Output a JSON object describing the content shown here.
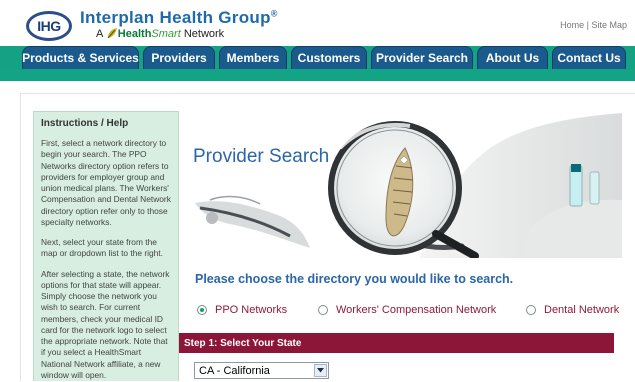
{
  "brand": {
    "logo_text": "IHG",
    "name": "Interplan Health Group",
    "registered": "®",
    "tagline_prefix": "A",
    "tagline_health": "Health",
    "tagline_smart": "Smart",
    "tagline_suffix": "Network"
  },
  "top_links": {
    "home": "Home",
    "separator": " | ",
    "sitemap": "Site Map"
  },
  "nav": {
    "items": [
      {
        "label": "Products & Services"
      },
      {
        "label": "Providers"
      },
      {
        "label": "Members"
      },
      {
        "label": "Customers"
      },
      {
        "label": "Provider Search"
      },
      {
        "label": "About Us"
      },
      {
        "label": "Contact Us"
      }
    ]
  },
  "sidebar": {
    "title": "Instructions / Help",
    "paragraphs": [
      "First, select a network directory to begin your search. The PPO Networks directory option refers to providers for employer group and union medical plans. The Workers' Compensation and Dental Network directory option refer only to those specialty networks.",
      "Next, select your state from the map or dropdown list to the right.",
      "After selecting a state, the network options for that state will appear. Simply choose the network you wish to search. For current members, check your medical ID card for the network logo to select the appropriate network. Note that if you select a HealthSmart National Network affiliate, a new window will open."
    ]
  },
  "main": {
    "title": "Provider Search",
    "prompt": "Please choose the directory you would like to search.",
    "directories": [
      {
        "label": "PPO Networks",
        "checked": true
      },
      {
        "label": "Workers' Compensation Network",
        "checked": false
      },
      {
        "label": "Dental Network",
        "checked": false
      }
    ],
    "step1_label": "Step 1: Select Your State",
    "state_value": "CA - California"
  },
  "colors": {
    "nav_tab": "#1b5a8c",
    "nav_band": "#14a184",
    "title_blue": "#2a66a8",
    "step_bar": "#8c1638",
    "radio_label": "#8e1b3a",
    "sidebar_bg": "#d7eee0"
  }
}
